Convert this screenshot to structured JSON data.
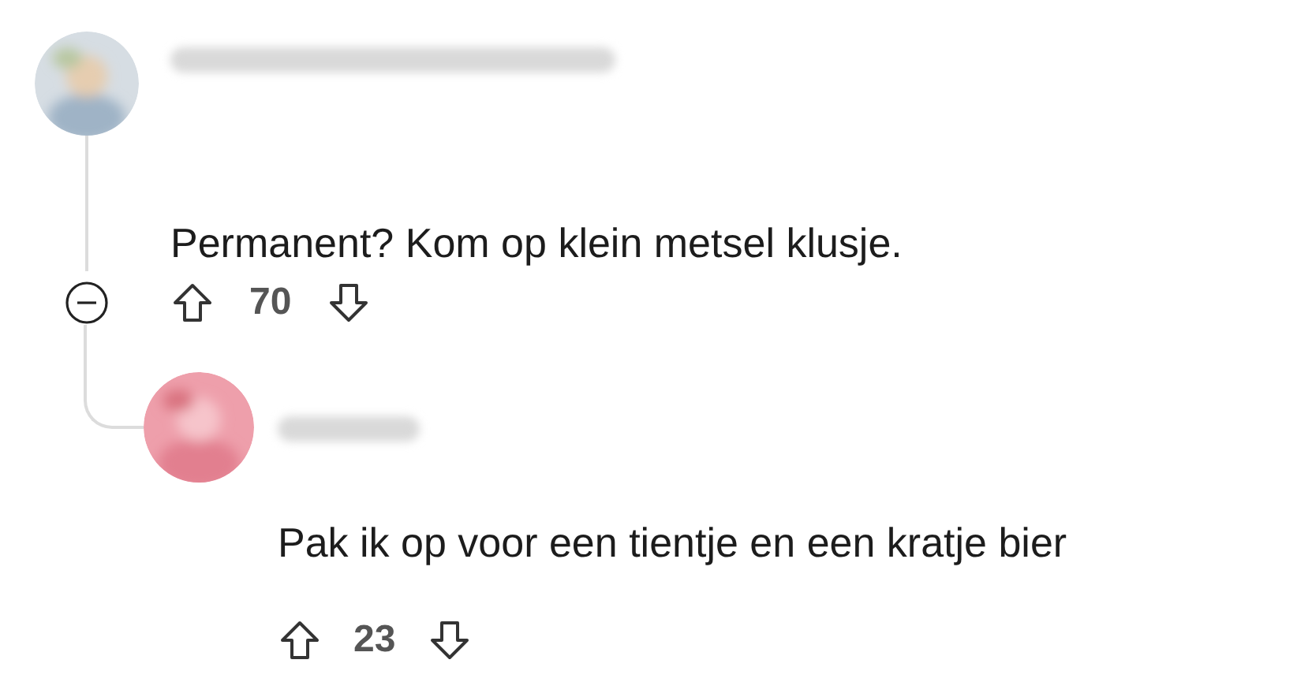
{
  "comments": [
    {
      "text": "Permanent? Kom op klein metsel klusje.",
      "score": "70",
      "expanded": true,
      "children": [
        {
          "text": "Pak ik op voor een tientje en een kratje bier",
          "score": "23"
        }
      ]
    }
  ]
}
